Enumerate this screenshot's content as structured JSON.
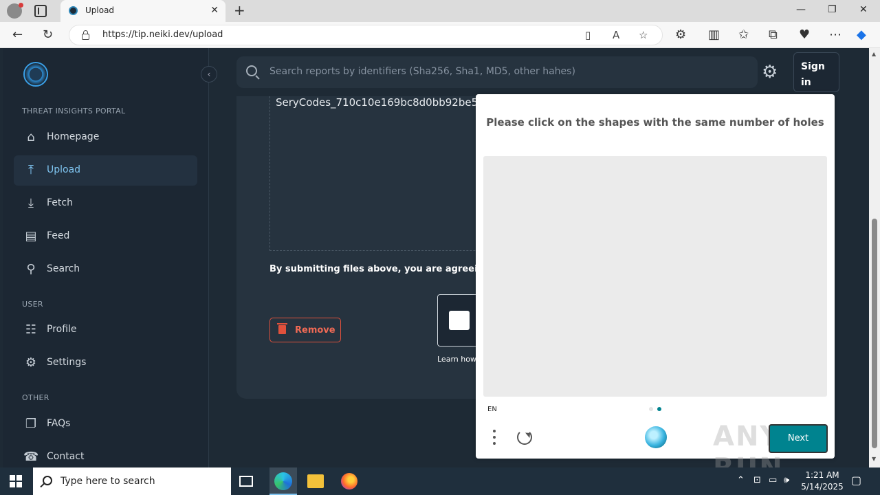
{
  "browser": {
    "tab_title": "Upload",
    "url": "https://tip.neiki.dev/upload"
  },
  "sidebar": {
    "sections": [
      {
        "label": "THREAT INSIGHTS PORTAL"
      },
      {
        "label": "USER"
      },
      {
        "label": "OTHER"
      }
    ],
    "items": [
      {
        "label": "Homepage",
        "icon": "home-icon"
      },
      {
        "label": "Upload",
        "icon": "upload-icon",
        "active": true
      },
      {
        "label": "Fetch",
        "icon": "fetch-icon"
      },
      {
        "label": "Feed",
        "icon": "feed-icon"
      },
      {
        "label": "Search",
        "icon": "search-icon"
      },
      {
        "label": "Profile",
        "icon": "profile-icon"
      },
      {
        "label": "Settings",
        "icon": "gear-icon"
      },
      {
        "label": "FAQs",
        "icon": "faq-icon"
      },
      {
        "label": "Contact",
        "icon": "contact-icon"
      }
    ]
  },
  "header": {
    "search_placeholder": "Search reports by identifiers (Sha256, Sha1, MD5, other hahes)",
    "signin_label": "Sign in"
  },
  "upload": {
    "filename": "SeryCodes_710c10e169bc8d0bb92be5",
    "agreement_text": "By submitting files above, you are agreeing to",
    "remove_label": "Remove",
    "learn_text": "Learn how"
  },
  "captcha": {
    "prompt": "Please click on the shapes with the same number of holes",
    "language": "EN",
    "next_label": "Next",
    "watermark": "ANY RUN",
    "accent_color": "#00838f"
  },
  "taskbar": {
    "search_placeholder": "Type here to search",
    "time": "1:21 AM",
    "date": "5/14/2025"
  }
}
